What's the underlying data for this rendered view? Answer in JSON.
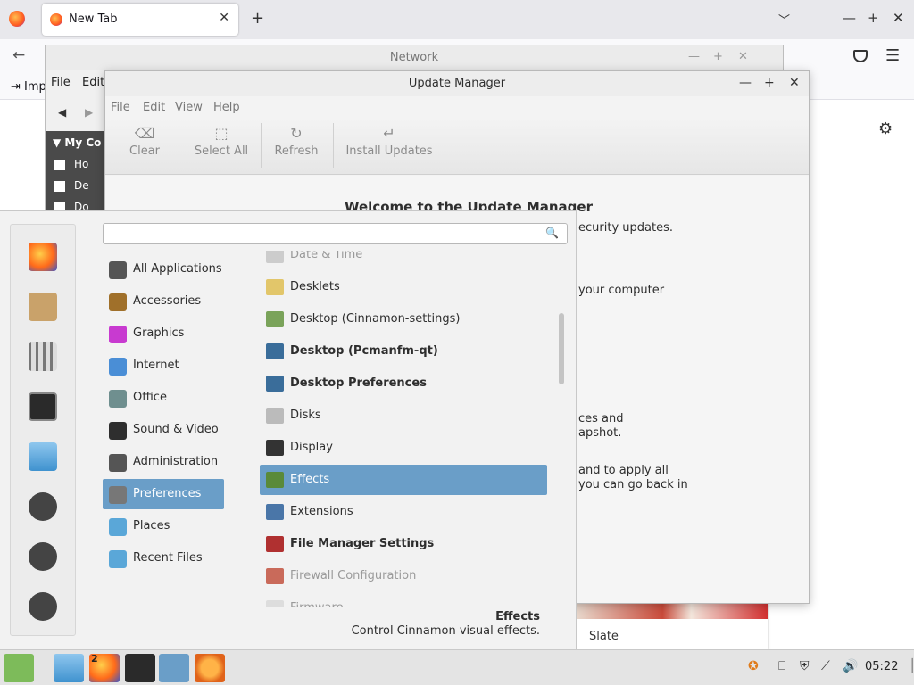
{
  "firefox": {
    "tab_title": "New Tab",
    "new_tab": "+",
    "tab_close": "✕",
    "import_label": "Imp",
    "card_label": "Slate"
  },
  "network_window": {
    "title": "Network",
    "menu": [
      "File",
      "Edit"
    ],
    "sidebar_header": "My Co",
    "sidebar_items": [
      "Ho",
      "De",
      "Do"
    ]
  },
  "update_manager": {
    "title": "Update Manager",
    "menu": [
      "File",
      "Edit",
      "View",
      "Help"
    ],
    "toolbar": [
      {
        "label": "Clear",
        "icon": "clear-icon"
      },
      {
        "label": "Select All",
        "icon": "select-all-icon"
      },
      {
        "label": "Refresh",
        "icon": "refresh-icon"
      },
      {
        "label": "Install Updates",
        "icon": "install-icon"
      }
    ],
    "welcome": "Welcome to the Update Manager",
    "visible_lines": [
      "ecurity updates.",
      "your computer",
      "ces and",
      "apshot.",
      "and to apply all",
      "you can go back in"
    ]
  },
  "menu": {
    "search_placeholder": "",
    "categories": [
      {
        "label": "All Applications",
        "icon": "grid-icon",
        "color": "#555555"
      },
      {
        "label": "Accessories",
        "icon": "accessories-icon",
        "color": "#a0702a"
      },
      {
        "label": "Graphics",
        "icon": "graphics-icon",
        "color": "#c83ad0"
      },
      {
        "label": "Internet",
        "icon": "internet-icon",
        "color": "#4a8ed6"
      },
      {
        "label": "Office",
        "icon": "office-icon",
        "color": "#6f8f8f"
      },
      {
        "label": "Sound & Video",
        "icon": "sound-video-icon",
        "color": "#2e2e2e"
      },
      {
        "label": "Administration",
        "icon": "administration-icon",
        "color": "#555555"
      },
      {
        "label": "Preferences",
        "icon": "preferences-icon",
        "color": "#777777"
      },
      {
        "label": "Places",
        "icon": "places-icon",
        "color": "#5aa7d8"
      },
      {
        "label": "Recent Files",
        "icon": "recent-files-icon",
        "color": "#5aa7d8"
      }
    ],
    "selected_category": "Preferences",
    "apps": [
      {
        "label": "Date & Time",
        "style": "dim",
        "color": "#cccccc"
      },
      {
        "label": "Desklets",
        "style": "",
        "color": "#e2c66a"
      },
      {
        "label": "Desktop (Cinnamon-settings)",
        "style": "",
        "color": "#7aa35a"
      },
      {
        "label": "Desktop (Pcmanfm-qt)",
        "style": "b",
        "color": "#3a6d9a"
      },
      {
        "label": "Desktop Preferences",
        "style": "b",
        "color": "#3a6d9a"
      },
      {
        "label": "Disks",
        "style": "",
        "color": "#bbbbbb"
      },
      {
        "label": "Display",
        "style": "",
        "color": "#333333"
      },
      {
        "label": "Effects",
        "style": "",
        "color": "#5a8a3a"
      },
      {
        "label": "Extensions",
        "style": "",
        "color": "#4a76a8"
      },
      {
        "label": "File Manager Settings",
        "style": "b",
        "color": "#b03030"
      },
      {
        "label": "Firewall Configuration",
        "style": "dim",
        "color": "#c96a5a"
      },
      {
        "label": "Firmware",
        "style": "dim",
        "color": "#dddddd"
      }
    ],
    "selected_app": "Effects",
    "description_title": "Effects",
    "description_text": "Control Cinnamon visual effects."
  },
  "taskbar": {
    "firefox_count": "2",
    "clock": "05:22"
  }
}
